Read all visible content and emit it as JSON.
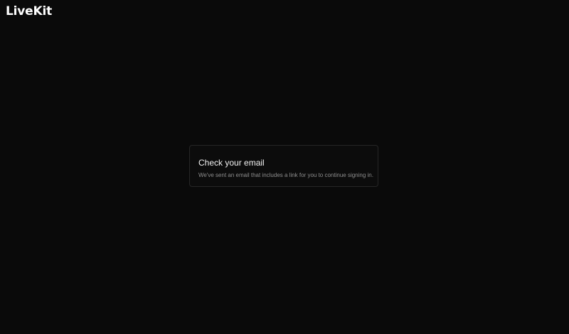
{
  "header": {
    "logo_text": "LiveKit"
  },
  "card": {
    "title": "Check your email",
    "message": "We've sent an email that includes a link for you to continue signing in."
  },
  "colors": {
    "background": "#0a0a0a",
    "card_border": "#262626",
    "title": "#f2f2f2",
    "message": "#8f8f8f"
  }
}
